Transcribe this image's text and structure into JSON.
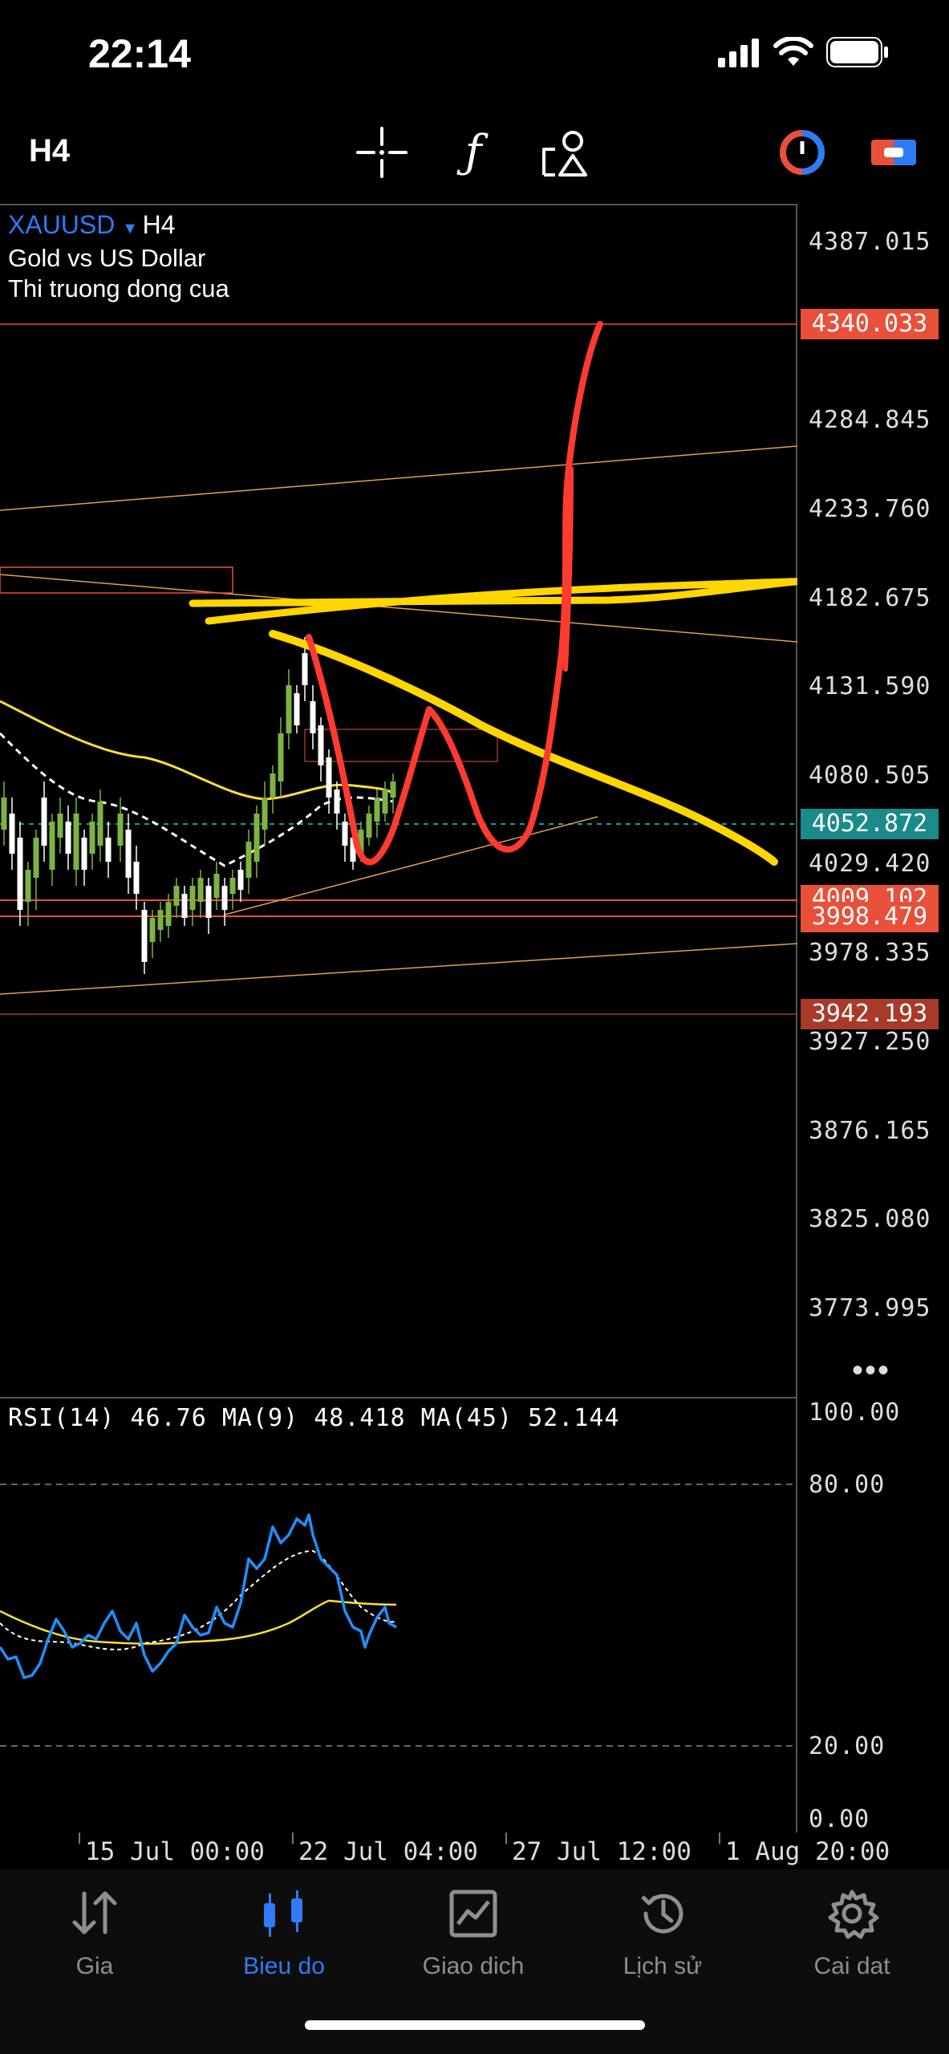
{
  "status_bar": {
    "time": "22:14"
  },
  "toolbar": {
    "timeframe": "H4"
  },
  "chart": {
    "symbol": "XAUUSD",
    "timeframe": "H4",
    "description": "Gold vs US Dollar",
    "market_status": "Thi truong dong cua",
    "price_axis": [
      "4387.015",
      "4284.845",
      "4233.760",
      "4182.675",
      "4131.590",
      "4080.505",
      "4029.420",
      "3978.335",
      "3927.250",
      "3876.165",
      "3825.080",
      "3773.995"
    ],
    "price_markers": [
      {
        "value": "4340.033",
        "color": "#e8503a"
      },
      {
        "value": "4052.872",
        "color": "#1a8a8a"
      },
      {
        "value": "4009.102",
        "color": "#e8503a"
      },
      {
        "value": "3998.479",
        "color": "#e8503a"
      },
      {
        "value": "3942.193",
        "color": "#a83a2a"
      }
    ],
    "more_menu": "•••"
  },
  "rsi": {
    "header": "RSI(14) 46.76 MA(9) 48.418 MA(45) 52.144",
    "levels": [
      "100.00",
      "80.00",
      "20.00",
      "0.00"
    ]
  },
  "time_axis": [
    "15 Jul 00:00",
    "22 Jul 04:00",
    "27 Jul 12:00",
    "1 Aug 20:00"
  ],
  "nav": [
    {
      "label": "Gia",
      "icon": "quotes-arrows-icon",
      "active": false
    },
    {
      "label": "Bieu do",
      "icon": "candlestick-chart-icon",
      "active": true
    },
    {
      "label": "Giao dich",
      "icon": "trade-chart-icon",
      "active": false
    },
    {
      "label": "Lịch sử",
      "icon": "history-clock-icon",
      "active": false
    },
    {
      "label": "Cai dat",
      "icon": "settings-gear-icon",
      "active": false
    }
  ],
  "colors": {
    "accent": "#2f7bf5",
    "bull": "#7cb342",
    "bear": "#ffffff",
    "drawing_yellow": "#ffd600",
    "drawing_red": "#ff3b30"
  }
}
